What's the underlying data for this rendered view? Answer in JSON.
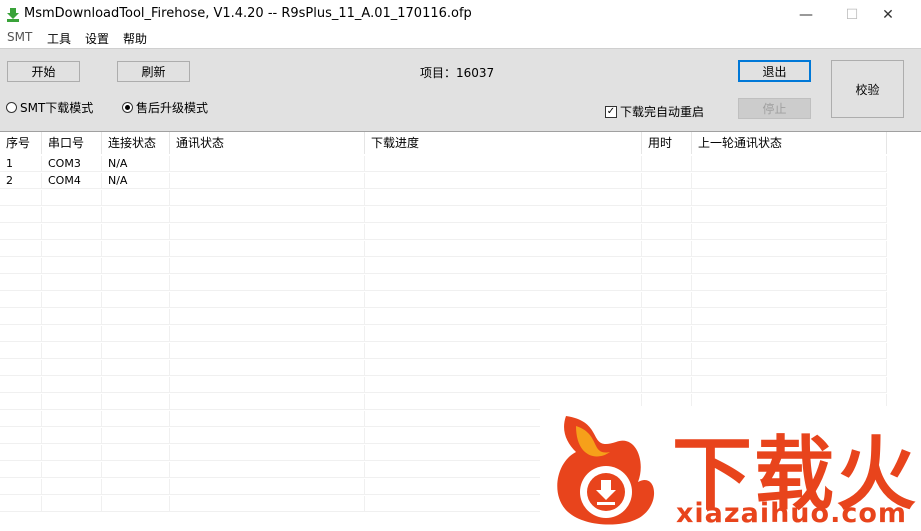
{
  "window": {
    "title": "MsmDownloadTool_Firehose, V1.4.20 -- R9sPlus_11_A.01_170116.ofp",
    "minimize": "—",
    "maximize": "☐",
    "close": "✕"
  },
  "menu": [
    "SMT",
    "工具",
    "设置",
    "帮助"
  ],
  "toolbar": {
    "start_label": "开始",
    "refresh_label": "刷新",
    "project_label": "项目：",
    "project_value": "16037",
    "exit_label": "退出",
    "stop_label": "停止",
    "verify_label": "校验",
    "mode_smt_label": "SMT下载模式",
    "mode_aftersales_label": "售后升级模式",
    "auto_reboot_label": "下载完自动重启",
    "auto_reboot_checked": true,
    "selected_mode": "aftersales"
  },
  "table": {
    "columns": [
      "序号",
      "串口号",
      "连接状态",
      "通讯状态",
      "下载进度",
      "用时",
      "上一轮通讯状态"
    ],
    "rows": [
      [
        "1",
        "COM3",
        "N/A",
        "",
        "",
        "",
        ""
      ],
      [
        "2",
        "COM4",
        "N/A",
        "",
        "",
        "",
        ""
      ]
    ]
  },
  "watermark": {
    "brand": "下载火",
    "url": "xiazaihuo.com"
  },
  "colors": {
    "toolbar_bg": "#e1e1e1",
    "focus_border": "#0078d7",
    "app_icon": "#3aa33a",
    "watermark": "#e8441c"
  }
}
